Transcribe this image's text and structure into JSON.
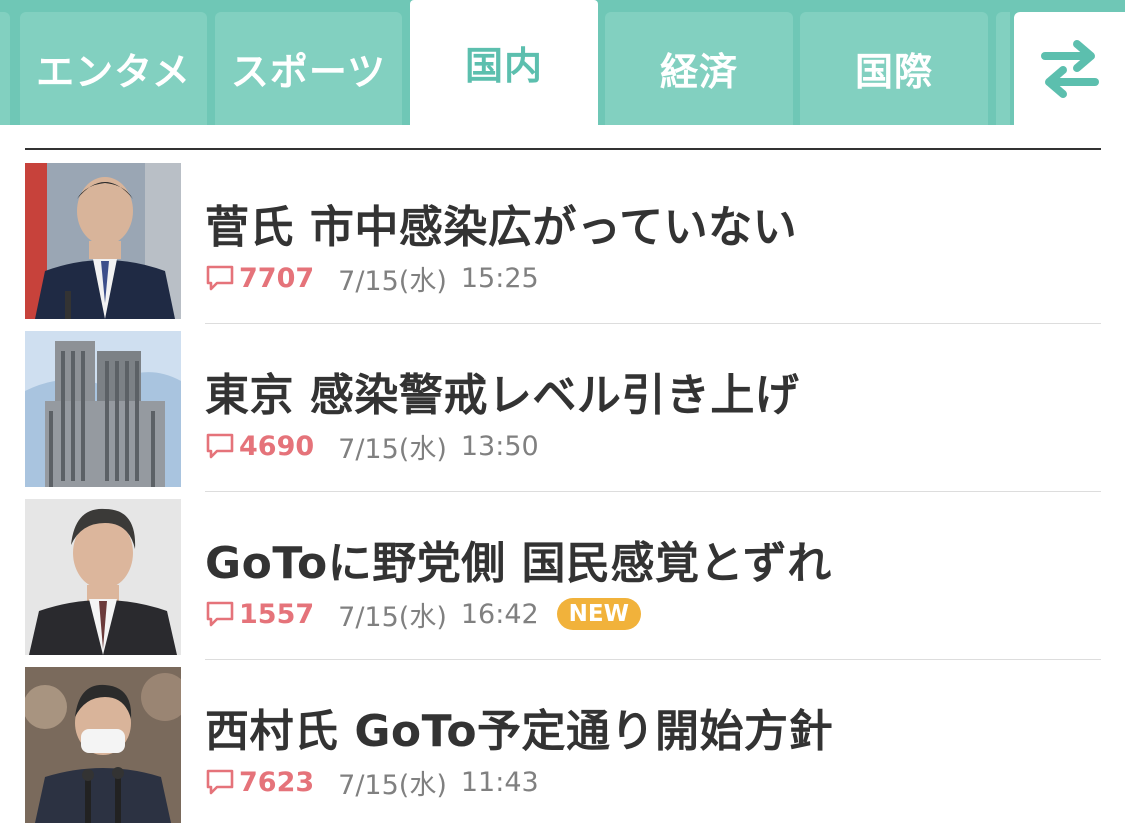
{
  "tabs": [
    {
      "label": "エンタメ",
      "active": false
    },
    {
      "label": "スポーツ",
      "active": false
    },
    {
      "label": "国内",
      "active": true
    },
    {
      "label": "経済",
      "active": false
    },
    {
      "label": "国際",
      "active": false
    }
  ],
  "switch_icon": "swap-arrows-icon",
  "colors": {
    "tab_bar": "#6fc7b6",
    "tab_inactive": "#82d0c0",
    "tab_active_text": "#5cbfae",
    "comment": "#e5737a",
    "new_badge": "#f1b23b"
  },
  "articles": [
    {
      "headline": "菅氏 市中感染広がっていない",
      "comments": "7707",
      "date": "7/15(水)",
      "time": "15:25",
      "is_new": false
    },
    {
      "headline": "東京 感染警戒レベル引き上げ",
      "comments": "4690",
      "date": "7/15(水)",
      "time": "13:50",
      "is_new": false
    },
    {
      "headline": "GoToに野党側 国民感覚とずれ",
      "comments": "1557",
      "date": "7/15(水)",
      "time": "16:42",
      "is_new": true,
      "badge": "NEW"
    },
    {
      "headline": "西村氏 GoTo予定通り開始方針",
      "comments": "7623",
      "date": "7/15(水)",
      "time": "11:43",
      "is_new": false
    }
  ]
}
